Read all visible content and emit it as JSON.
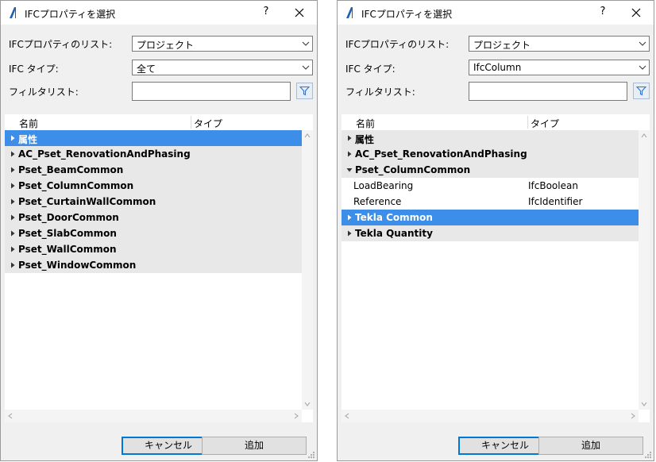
{
  "dialogs": [
    {
      "title": "IFCプロパティを選択",
      "help_label": "?",
      "list_label": "IFCプロパティのリスト:",
      "list_value": "プロジェクト",
      "type_label": "IFC タイプ:",
      "type_value": "全て",
      "filter_label": "フィルタリスト:",
      "filter_value": "",
      "columns": {
        "name": "名前",
        "type": "タイプ"
      },
      "rows": [
        {
          "label": "属性",
          "type": "",
          "kind": "group",
          "expanded": false,
          "selected": true
        },
        {
          "label": "AC_Pset_RenovationAndPhasing",
          "type": "",
          "kind": "group",
          "expanded": false,
          "selected": false
        },
        {
          "label": "Pset_BeamCommon",
          "type": "",
          "kind": "group",
          "expanded": false,
          "selected": false
        },
        {
          "label": "Pset_ColumnCommon",
          "type": "",
          "kind": "group",
          "expanded": false,
          "selected": false
        },
        {
          "label": "Pset_CurtainWallCommon",
          "type": "",
          "kind": "group",
          "expanded": false,
          "selected": false
        },
        {
          "label": "Pset_DoorCommon",
          "type": "",
          "kind": "group",
          "expanded": false,
          "selected": false
        },
        {
          "label": "Pset_SlabCommon",
          "type": "",
          "kind": "group",
          "expanded": false,
          "selected": false
        },
        {
          "label": "Pset_WallCommon",
          "type": "",
          "kind": "group",
          "expanded": false,
          "selected": false
        },
        {
          "label": "Pset_WindowCommon",
          "type": "",
          "kind": "group",
          "expanded": false,
          "selected": false
        }
      ],
      "cancel_label": "キャンセル",
      "add_label": "追加"
    },
    {
      "title": "IFCプロパティを選択",
      "help_label": "?",
      "list_label": "IFCプロパティのリスト:",
      "list_value": "プロジェクト",
      "type_label": "IFC タイプ:",
      "type_value": "IfcColumn",
      "filter_label": "フィルタリスト:",
      "filter_value": "",
      "columns": {
        "name": "名前",
        "type": "タイプ"
      },
      "rows": [
        {
          "label": "属性",
          "type": "",
          "kind": "group",
          "expanded": false,
          "selected": false
        },
        {
          "label": "AC_Pset_RenovationAndPhasing",
          "type": "",
          "kind": "group",
          "expanded": false,
          "selected": false
        },
        {
          "label": "Pset_ColumnCommon",
          "type": "",
          "kind": "group",
          "expanded": true,
          "selected": false
        },
        {
          "label": "LoadBearing",
          "type": "IfcBoolean",
          "kind": "child",
          "expanded": false,
          "selected": false
        },
        {
          "label": "Reference",
          "type": "IfcIdentifier",
          "kind": "child",
          "expanded": false,
          "selected": false
        },
        {
          "label": "Tekla Common",
          "type": "",
          "kind": "group",
          "expanded": false,
          "selected": true
        },
        {
          "label": "Tekla Quantity",
          "type": "",
          "kind": "group",
          "expanded": false,
          "selected": false
        }
      ],
      "cancel_label": "キャンセル",
      "add_label": "追加"
    }
  ],
  "colors": {
    "selection": "#3d8ee8",
    "group_row": "#e8e8e8",
    "default_button_border": "#0078d7"
  },
  "icons": [
    "archicad-logo-icon",
    "close-icon",
    "chevron-down-icon",
    "filter-icon",
    "caret-right-icon",
    "caret-down-icon",
    "scroll-arrow-icon",
    "resize-grip-icon"
  ]
}
